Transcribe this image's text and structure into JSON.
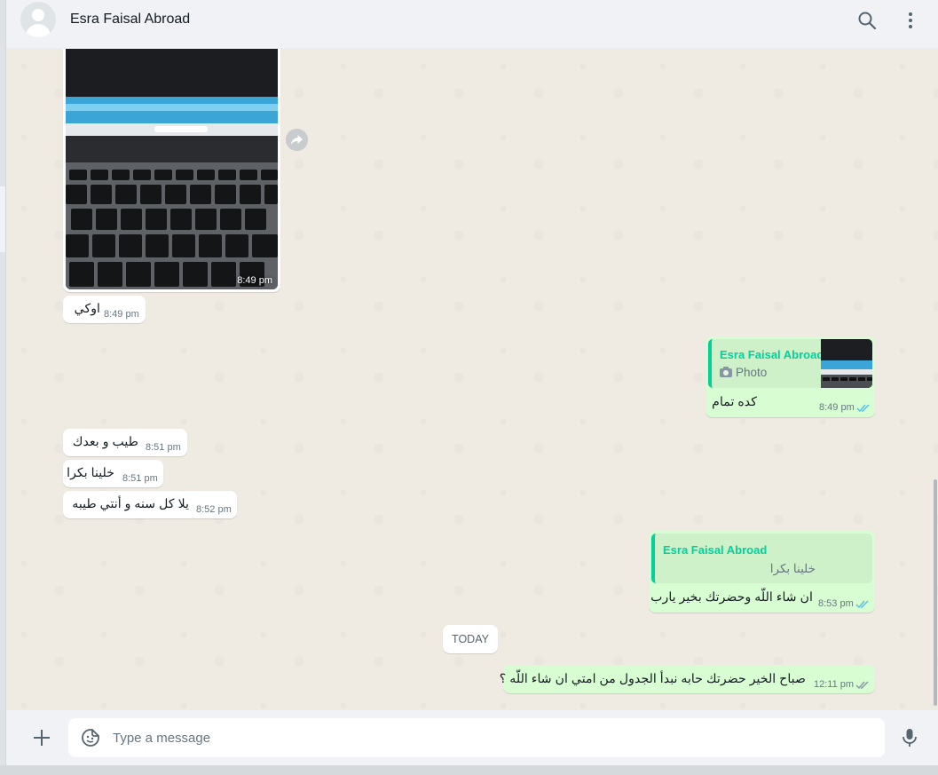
{
  "header": {
    "contact_name": "Esra Faisal Abroad"
  },
  "messages": {
    "photo": {
      "time": "8:49 pm"
    },
    "m1": {
      "text": "اوكي",
      "time": "8:49 pm"
    },
    "m2": {
      "quote_author": "Esra Faisal Abroad",
      "quote_type": "Photo",
      "text": "كده تمام",
      "time": "8:49 pm"
    },
    "m3": {
      "text": "طيب و بعدك",
      "time": "8:51 pm"
    },
    "m4": {
      "text": "خلينا بكرا",
      "time": "8:51 pm"
    },
    "m5": {
      "text": "يلا كل سنه و أنتي طيبه",
      "time": "8:52 pm"
    },
    "m6": {
      "quote_author": "Esra Faisal Abroad",
      "quote_text": "خلينا بكرا",
      "text": "ان شاء اللّه وحضرتك بخير يارب",
      "time": "8:53 pm"
    },
    "day_separator": "TODAY",
    "m7": {
      "text": "صباح الخير حضرتك حابه نبدأ الجدول من امتي ان شاء اللّه ؟",
      "time": "12:11 pm"
    }
  },
  "footer": {
    "placeholder": "Type a message"
  },
  "icons": {
    "search": "search-icon",
    "menu": "menu-dots-icon",
    "attach": "plus-icon",
    "sticker": "sticker-icon",
    "mic": "mic-icon",
    "forward": "forward-icon",
    "ticks": "double-check-icon",
    "camera": "camera-icon"
  },
  "colors": {
    "incoming": "#ffffff",
    "outgoing": "#d9fdd3",
    "accent": "#06cf9c",
    "read_ticks": "#53bdeb",
    "background": "#efeae2"
  }
}
